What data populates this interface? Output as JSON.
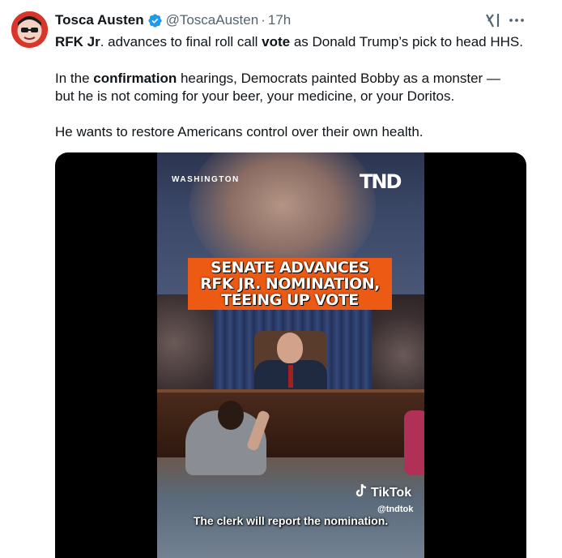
{
  "tweet": {
    "author_name": "Tosca Austen",
    "handle": "@ToscaAusten",
    "separator": "·",
    "time": "17h",
    "line1": [
      {
        "text": "RFK Jr",
        "bold": true
      },
      {
        "text": ". advances to final roll call ",
        "bold": false
      },
      {
        "text": "vote",
        "bold": true
      },
      {
        "text": " as Donald Trump’s pick to head HHS.",
        "bold": false
      }
    ],
    "line2": [
      {
        "text": "In the ",
        "bold": false
      },
      {
        "text": "confirmation",
        "bold": true
      },
      {
        "text": " hearings, Democrats painted Bobby as a monster —",
        "bold": false
      }
    ],
    "line3": "but he is not coming for your beer, your medicine, or your Doritos.",
    "line4": "He wants to restore Americans control over their own health."
  },
  "video": {
    "location_label": "WASHINGTON",
    "brand_logo": "TND",
    "headline_lines": [
      "SENATE ADVANCES",
      "RFK JR. NOMINATION,",
      "TEEING UP VOTE"
    ],
    "tiktok_label": "TikTok",
    "tiktok_handle": "@tndtok",
    "caption": "The clerk will report the nomination."
  },
  "icons": {
    "verified": "verified-badge-icon",
    "grok": "grok-icon",
    "more": "more-icon",
    "tiktok": "tiktok-icon"
  },
  "colors": {
    "accent": "#1d9bf0",
    "headline_bg": "#ec5a14",
    "secondary_text": "#536471"
  }
}
